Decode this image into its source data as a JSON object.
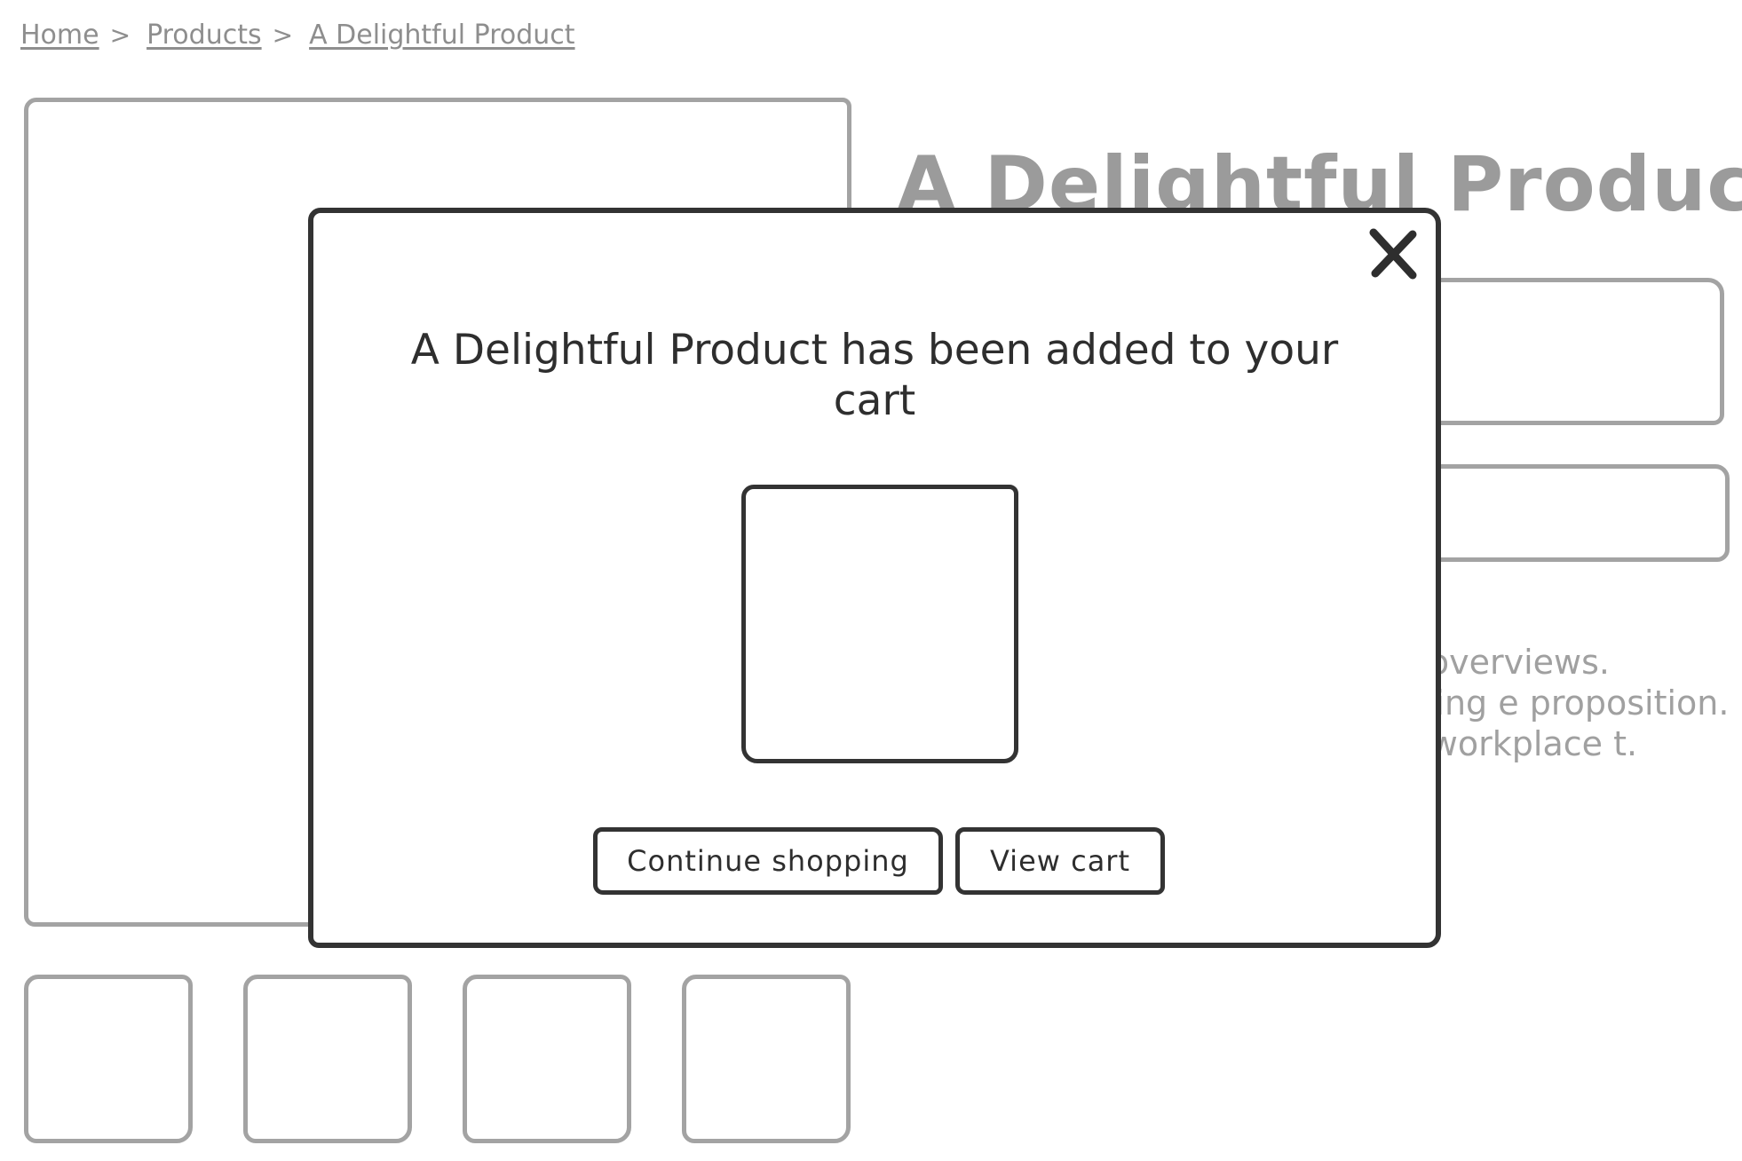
{
  "breadcrumb": {
    "items": [
      "Home",
      "Products",
      "A Delightful Product"
    ],
    "separator": ">"
  },
  "product": {
    "title": "A Delightful Product",
    "description": "to provide a vel overviews. rporate ive thinking e proposition. ric world view a workplace t."
  },
  "modal": {
    "heading": "A Delightful Product has been added to your cart",
    "close_icon": "close-icon",
    "continue_label": "Continue shopping",
    "view_cart_label": "View cart"
  },
  "colors": {
    "modal_stroke": "#333333",
    "background_stroke": "#a3a3a3",
    "background_text": "#9b9b9b"
  }
}
